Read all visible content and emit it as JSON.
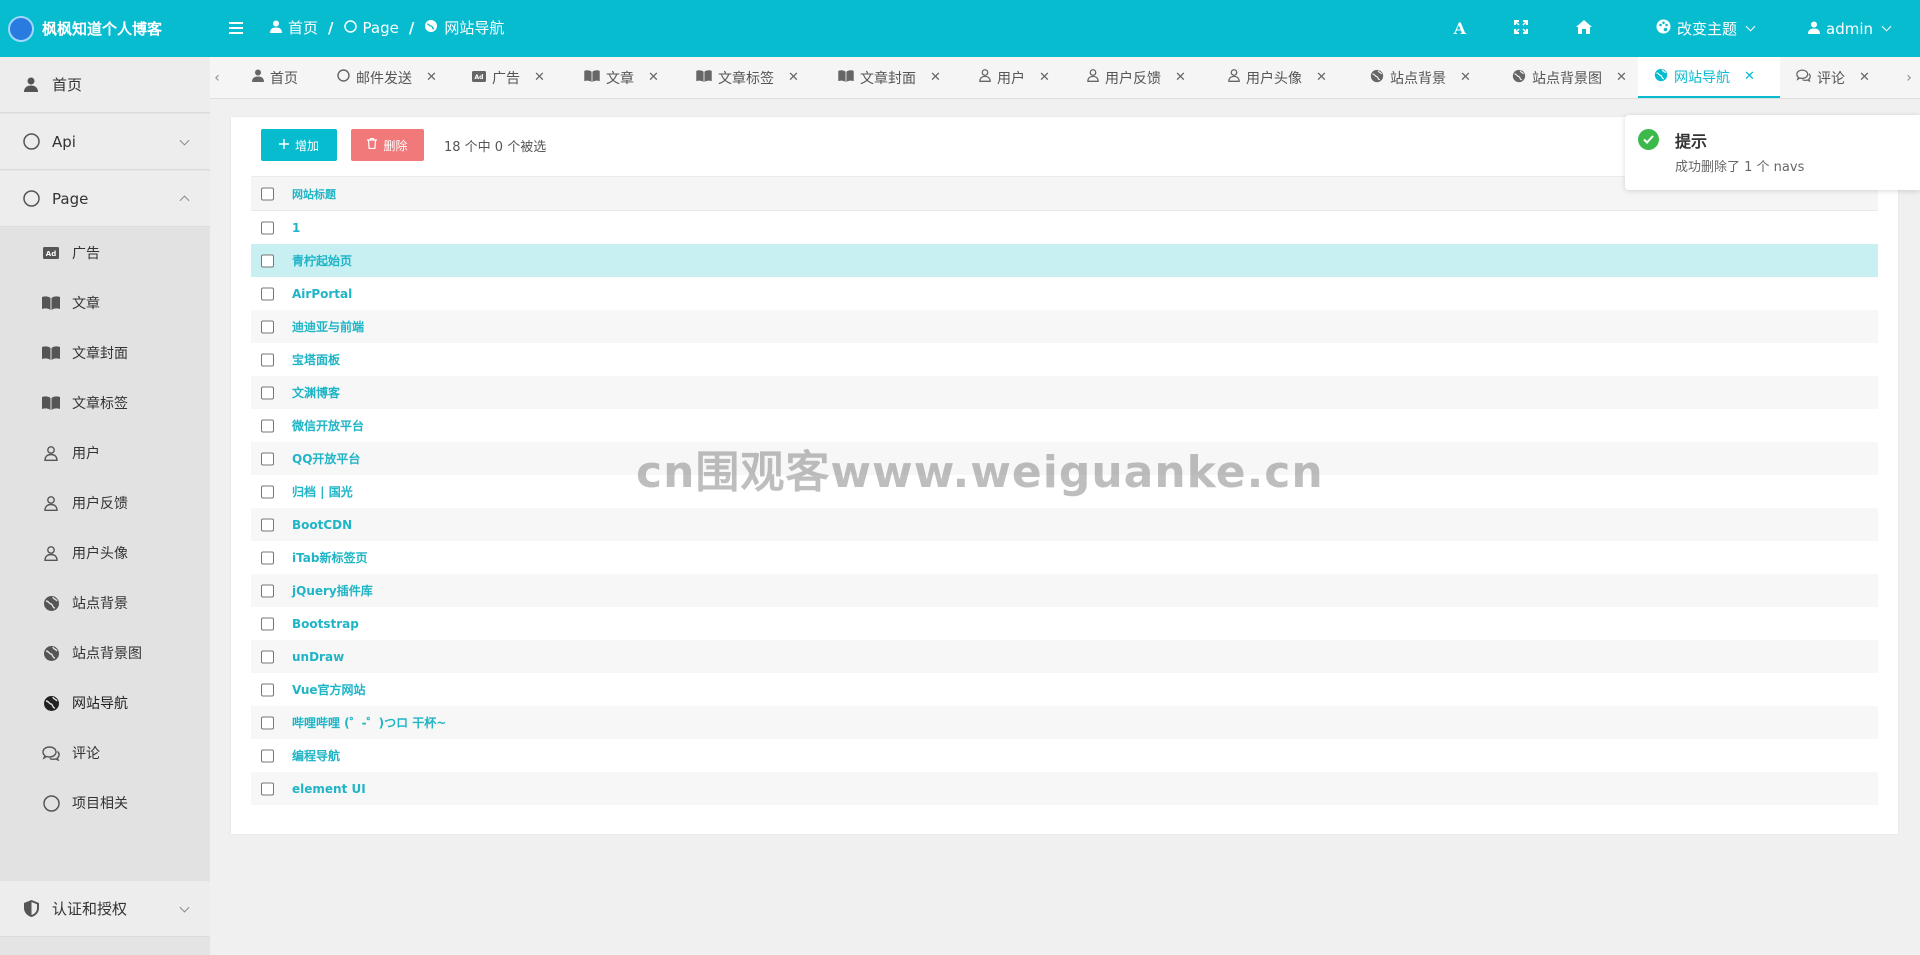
{
  "app": {
    "title": "枫枫知道个人博客"
  },
  "breadcrumb": {
    "home": "首页",
    "page": "Page",
    "current": "网站导航"
  },
  "header": {
    "font_label": "A",
    "theme_label": "改变主题",
    "user_label": "admin"
  },
  "sidebar": {
    "home": "首页",
    "api": "Api",
    "page": "Page",
    "subitems": [
      "广告",
      "文章",
      "文章封面",
      "文章标签",
      "用户",
      "用户反馈",
      "用户头像",
      "站点背景",
      "站点背景图",
      "网站导航",
      "评论",
      "项目相关"
    ],
    "auth": "认证和授权"
  },
  "tabs": [
    "首页",
    "邮件发送",
    "广告",
    "文章",
    "文章标签",
    "文章封面",
    "用户",
    "用户反馈",
    "用户头像",
    "站点背景",
    "站点背景图",
    "网站导航",
    "评论"
  ],
  "toolbar": {
    "add_label": "增加",
    "delete_label": "删除",
    "selection_info": "18 个中 0 个被选"
  },
  "table": {
    "header": "网站标题",
    "rows": [
      "1",
      "青柠起始页",
      "AirPortal",
      "迪迪亚与前端",
      "宝塔面板",
      "文渊博客",
      "微信开放平台",
      "QQ开放平台",
      "归档 | 国光",
      "BootCDN",
      "iTab新标签页",
      "jQuery插件库",
      "Bootstrap",
      "unDraw",
      "Vue官方网站",
      "哔哩哔哩 (゜-゜)つロ 干杯~",
      "编程导航",
      "element UI"
    ]
  },
  "toast": {
    "title": "提示",
    "message": "成功删除了 1 个 navs"
  },
  "watermark": "cn围观客www.weiguanke.cn",
  "colors": {
    "primary": "#08bcd0",
    "danger": "#f2797a",
    "success": "#3cb94a",
    "highlight": "#c8eff2"
  }
}
